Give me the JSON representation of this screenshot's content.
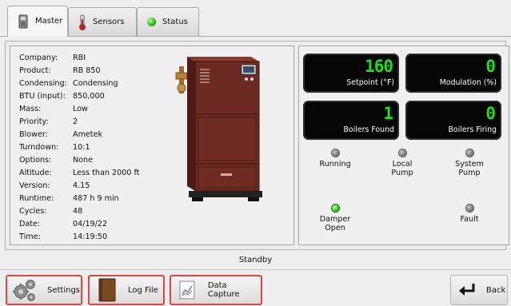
{
  "tabs": [
    {
      "label": "Master",
      "icon": "boiler-icon",
      "active": true
    },
    {
      "label": "Sensors",
      "icon": "thermometer-icon",
      "active": false
    },
    {
      "label": "Status",
      "icon": "green-status-led-icon",
      "active": false
    }
  ],
  "info": [
    {
      "key": "Company:",
      "value": "RBI"
    },
    {
      "key": "Product:",
      "value": "RB 850"
    },
    {
      "key": "Condensing:",
      "value": "Condensing"
    },
    {
      "key": "BTU (input):",
      "value": "850,000"
    },
    {
      "key": "Mass:",
      "value": "Low"
    },
    {
      "key": "Priority:",
      "value": "2"
    },
    {
      "key": "Blower:",
      "value": "Ametek"
    },
    {
      "key": "Turndown:",
      "value": "10:1"
    },
    {
      "key": "Options:",
      "value": "None"
    },
    {
      "key": "Altitude:",
      "value": "Less than 2000 ft"
    },
    {
      "key": "Version:",
      "value": "4.15"
    },
    {
      "key": "Runtime:",
      "value": "487 h 9 min"
    },
    {
      "key": "Cycles:",
      "value": "48"
    },
    {
      "key": "Date:",
      "value": "04/19/22"
    },
    {
      "key": "Time:",
      "value": "14:19:50"
    }
  ],
  "displays": [
    {
      "value": "160",
      "label": "Setpoint (°F)"
    },
    {
      "value": "0",
      "label": "Modulation (%)"
    },
    {
      "value": "1",
      "label": "Boilers Found"
    },
    {
      "value": "0",
      "label": "Boilers Firing"
    }
  ],
  "indicators": [
    {
      "line1": "Running",
      "line2": "",
      "on": false
    },
    {
      "line1": "Local",
      "line2": "Pump",
      "on": false
    },
    {
      "line1": "System",
      "line2": "Pump",
      "on": false
    },
    {
      "line1": "Damper",
      "line2": "Open",
      "on": true
    },
    {
      "line1": "Fault",
      "line2": "",
      "on": false
    }
  ],
  "status_text": "Standby",
  "buttons": {
    "settings": "Settings",
    "log_file": "Log File",
    "data_capture": "Data Capture",
    "back": "Back"
  },
  "colors": {
    "display_digits": "#19e119",
    "highlight_border": "#e0453f",
    "boiler_cabinet": "#6b2a22"
  }
}
